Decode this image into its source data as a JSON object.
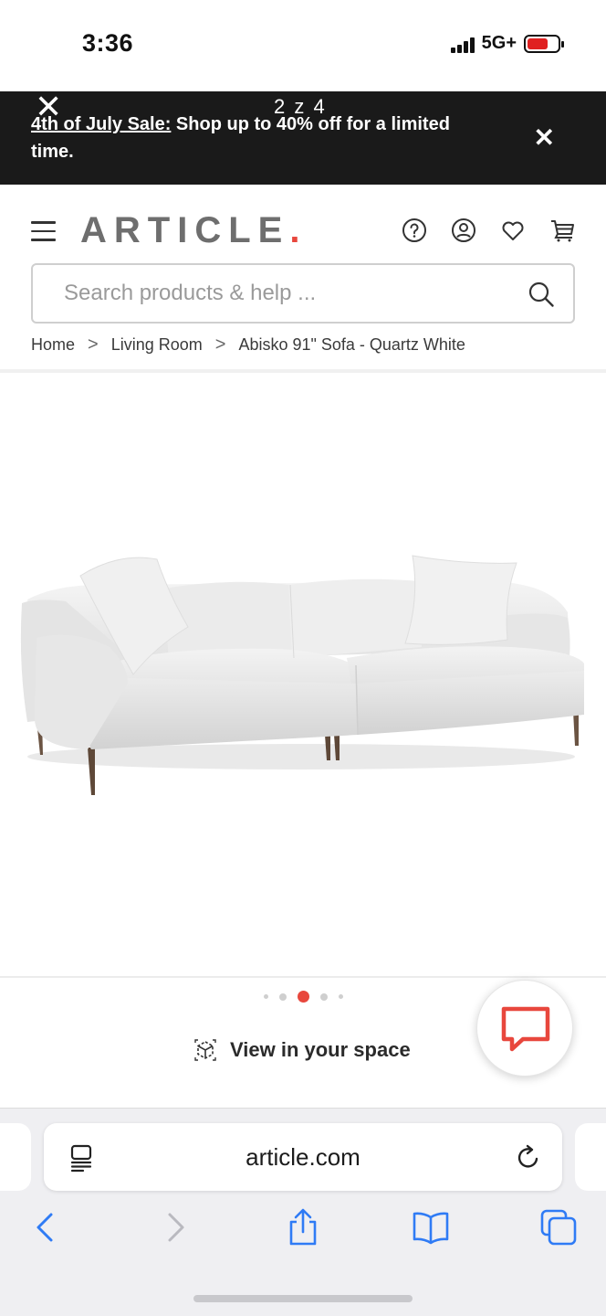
{
  "status_bar": {
    "time": "3:36",
    "network": "5G+",
    "battery_level": 0.7,
    "battery_color": "#e02020"
  },
  "overlay": {
    "close_glyph": "✕",
    "counter": "2 z 4"
  },
  "promo": {
    "sale_link": "4th of July Sale:",
    "message": " Shop up to 40% off for a limited time.",
    "close_glyph": "✕"
  },
  "header": {
    "logo": "ARTICLE",
    "logo_dot": ".",
    "logo_accent": "#e8473d",
    "icons": [
      "menu-icon",
      "help-icon",
      "account-icon",
      "heart-icon",
      "cart-icon"
    ]
  },
  "search": {
    "placeholder": "Search products & help ..."
  },
  "breadcrumb": {
    "items": [
      "Home",
      "Living Room",
      "Abisko 91\" Sofa - Quartz White"
    ],
    "separator": ">"
  },
  "carousel": {
    "dot_count": 5,
    "active_index": 2,
    "active_color": "#e8473d"
  },
  "view_in_space": {
    "label": "View in your space"
  },
  "chat": {
    "icon": "chat-icon",
    "color": "#e8473d"
  },
  "browser": {
    "url": "article.com",
    "accent": "#2f7bf5",
    "icons": [
      "reader-icon",
      "reload-icon",
      "back-icon",
      "forward-icon",
      "share-icon",
      "bookmarks-icon",
      "tabs-icon"
    ]
  }
}
